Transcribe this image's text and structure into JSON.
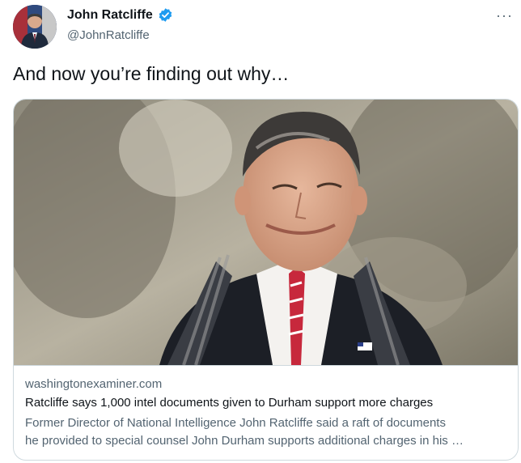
{
  "tweet": {
    "author_name": "John Ratcliffe",
    "author_handle": "@JohnRatcliffe",
    "more_label": "···",
    "text": "And now you’re finding out why…"
  },
  "card": {
    "domain": "washingtonexaminer.com",
    "headline": "Ratcliffe says 1,000 intel documents given to Durham support more charges",
    "description_line1": "Former Director of National Intelligence John Ratcliffe said a raft of documents",
    "description_line2": "he provided to special counsel John Durham supports additional charges in his …"
  },
  "colors": {
    "verified_blue": "#1d9bf0",
    "text_primary": "#0f1419",
    "text_secondary": "#536471",
    "border": "#cfd9de"
  }
}
